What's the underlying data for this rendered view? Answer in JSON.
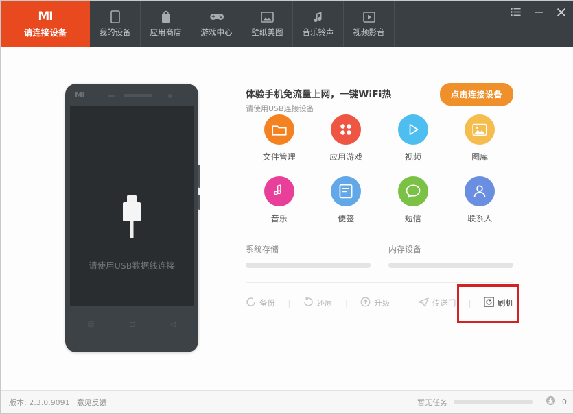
{
  "header": {
    "brand": {
      "logo": "MI",
      "label": "请连接设备",
      "icon": "mi-logo-icon",
      "accent": "#e8491e"
    },
    "tabs": [
      {
        "label": "我的设备",
        "icon": "device-icon"
      },
      {
        "label": "应用商店",
        "icon": "shopping-bag-icon"
      },
      {
        "label": "游戏中心",
        "icon": "gamepad-icon"
      },
      {
        "label": "壁纸美图",
        "icon": "wallpaper-icon"
      },
      {
        "label": "音乐铃声",
        "icon": "music-note-icon"
      },
      {
        "label": "视频影音",
        "icon": "video-play-icon"
      }
    ],
    "window_controls": [
      {
        "name": "menu-list-icon",
        "glyph": "≔"
      },
      {
        "name": "minimize-icon",
        "glyph": "—"
      },
      {
        "name": "close-icon",
        "glyph": "✕"
      }
    ]
  },
  "phone": {
    "logo": "MI",
    "screen_hint": "请使用USB数据线连接",
    "nav_buttons": [
      "menu",
      "home",
      "back"
    ]
  },
  "promo": {
    "title": "体验手机免流量上网，一键WiFi热",
    "subtitle": "请使用USB连接设备",
    "button_label": "点击连接设备",
    "button_color": "#f0902b"
  },
  "grid": [
    {
      "label": "文件管理",
      "icon": "folder-icon",
      "color": "#f58220"
    },
    {
      "label": "应用游戏",
      "icon": "apps-dots-icon",
      "color": "#ee5643"
    },
    {
      "label": "视频",
      "icon": "play-icon",
      "color": "#4ebdf0"
    },
    {
      "label": "图库",
      "icon": "image-icon",
      "color": "#f5bc4e"
    },
    {
      "label": "音乐",
      "icon": "music-icon",
      "color": "#e8409a"
    },
    {
      "label": "便签",
      "icon": "note-icon",
      "color": "#62a8e8"
    },
    {
      "label": "短信",
      "icon": "chat-icon",
      "color": "#7bc145"
    },
    {
      "label": "联系人",
      "icon": "person-icon",
      "color": "#6b8fe0"
    }
  ],
  "storage": [
    {
      "title": "系统存储",
      "percent": 0
    },
    {
      "title": "内存设备",
      "percent": 0
    }
  ],
  "actions": [
    {
      "label": "备份",
      "icon": "backup-circle-icon",
      "highlighted": false
    },
    {
      "label": "还原",
      "icon": "restore-icon",
      "highlighted": false
    },
    {
      "label": "升级",
      "icon": "upgrade-arrow-icon",
      "highlighted": false
    },
    {
      "label": "传送门",
      "icon": "send-paperplane-icon",
      "highlighted": false
    },
    {
      "label": "刷机",
      "icon": "flash-rom-icon",
      "highlighted": true
    }
  ],
  "separator": "|",
  "highlight": {
    "color": "#d42222"
  },
  "footer": {
    "version": "版本: 2.3.0.9091",
    "feedback": "意见反馈",
    "task_status": "暂无任务",
    "download_count": "0",
    "download_icon": "download-circle-icon"
  }
}
